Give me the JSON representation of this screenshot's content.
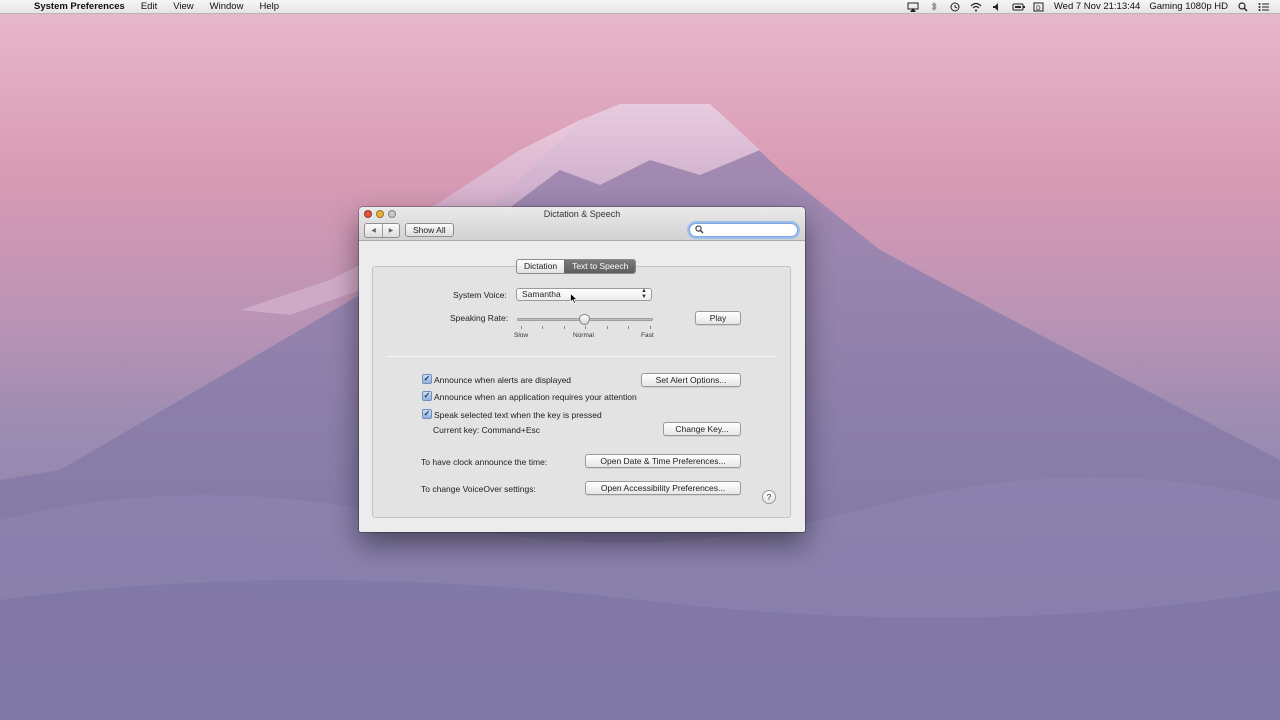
{
  "menubar": {
    "app_name": "System Preferences",
    "items": [
      "Edit",
      "View",
      "Window",
      "Help"
    ],
    "datetime": "Wed 7 Nov  21:13:44",
    "user": "Gaming 1080p HD",
    "status_icons": [
      "airplay-icon",
      "bluetooth-icon",
      "time-machine-icon",
      "wifi-icon",
      "volume-icon",
      "battery-icon",
      "input-source-icon"
    ]
  },
  "window": {
    "title": "Dictation & Speech",
    "toolbar": {
      "show_all": "Show All",
      "search_placeholder": ""
    },
    "tabs": [
      {
        "label": "Dictation",
        "active": false
      },
      {
        "label": "Text to Speech",
        "active": true
      }
    ],
    "system_voice": {
      "label": "System Voice:",
      "value": "Samantha"
    },
    "speaking_rate": {
      "label": "Speaking Rate:",
      "slow": "Slow",
      "normal": "Normal",
      "fast": "Fast",
      "play": "Play"
    },
    "options": {
      "alerts": {
        "label": "Announce when alerts are displayed",
        "checked": true,
        "button": "Set Alert Options..."
      },
      "attention": {
        "label": "Announce when an application requires your attention",
        "checked": true
      },
      "speak_selected": {
        "label": "Speak selected text when the key is pressed",
        "checked": true
      },
      "current_key": "Current key: Command+Esc",
      "change_key": "Change Key..."
    },
    "clock": {
      "label": "To have clock announce the time:",
      "button": "Open Date & Time Preferences..."
    },
    "voiceover": {
      "label": "To change VoiceOver settings:",
      "button": "Open Accessibility Preferences..."
    },
    "help": "?"
  }
}
